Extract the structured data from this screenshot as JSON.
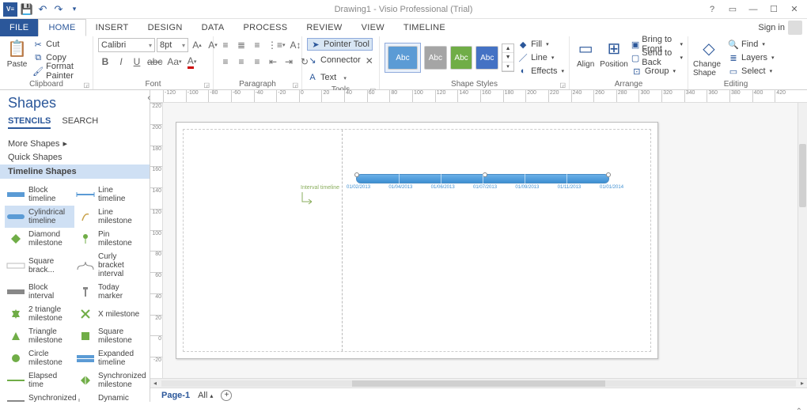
{
  "title": "Drawing1 - Visio Professional (Trial)",
  "signin": "Sign in",
  "tabs": [
    "FILE",
    "HOME",
    "INSERT",
    "DESIGN",
    "DATA",
    "PROCESS",
    "REVIEW",
    "VIEW",
    "TIMELINE"
  ],
  "active_tab": 1,
  "clipboard": {
    "paste": "Paste",
    "cut": "Cut",
    "copy": "Copy",
    "format_painter": "Format Painter",
    "label": "Clipboard"
  },
  "font": {
    "name": "Calibri",
    "size": "8pt",
    "label": "Font"
  },
  "paragraph": {
    "label": "Paragraph"
  },
  "tools": {
    "pointer": "Pointer Tool",
    "connector": "Connector",
    "text": "Text",
    "label": "Tools"
  },
  "shape_styles": {
    "label": "Shape Styles",
    "fill": "Fill",
    "line": "Line",
    "effects": "Effects",
    "swatch_text": "Abc"
  },
  "arrange": {
    "align": "Align",
    "position": "Position",
    "bring_front": "Bring to Front",
    "send_back": "Send to Back",
    "group": "Group",
    "label": "Arrange"
  },
  "editing": {
    "change_shape": "Change Shape",
    "find": "Find",
    "layers": "Layers",
    "select": "Select",
    "label": "Editing"
  },
  "shapes_pane": {
    "title": "Shapes",
    "stencils": "STENCILS",
    "search": "SEARCH",
    "more": "More Shapes",
    "quick": "Quick Shapes",
    "category": "Timeline Shapes",
    "items_left": [
      "Block timeline",
      "Cylindrical timeline",
      "Diamond milestone",
      "Square brack...",
      "Block interval",
      "2 triangle milestone",
      "Triangle milestone",
      "Circle milestone",
      "Elapsed time",
      "Synchronized interval"
    ],
    "items_right": [
      "Line timeline",
      "Line milestone",
      "Pin milestone",
      "Curly bracket interval",
      "Today marker",
      "X milestone",
      "Square milestone",
      "Expanded timeline",
      "Synchronized milestone",
      "Dynamic Connector"
    ]
  },
  "hruler": [
    -120,
    -100,
    -80,
    -60,
    -40,
    -20,
    0,
    20,
    40,
    60,
    80,
    100,
    120,
    140,
    160,
    180,
    200,
    220,
    240,
    260,
    280,
    300,
    320,
    340,
    360,
    380,
    400,
    420
  ],
  "vruler": [
    220,
    200,
    180,
    160,
    140,
    120,
    100,
    80,
    60,
    40,
    20,
    0,
    -20
  ],
  "timeline_dates": [
    "01/02/2013",
    "01/04/2013",
    "01/06/2013",
    "01/07/2013",
    "01/09/2013",
    "01/11/2013",
    "01/01/2014"
  ],
  "timeline_annotation": "Interval timeline",
  "page_tabs": {
    "page": "Page-1",
    "all": "All"
  }
}
